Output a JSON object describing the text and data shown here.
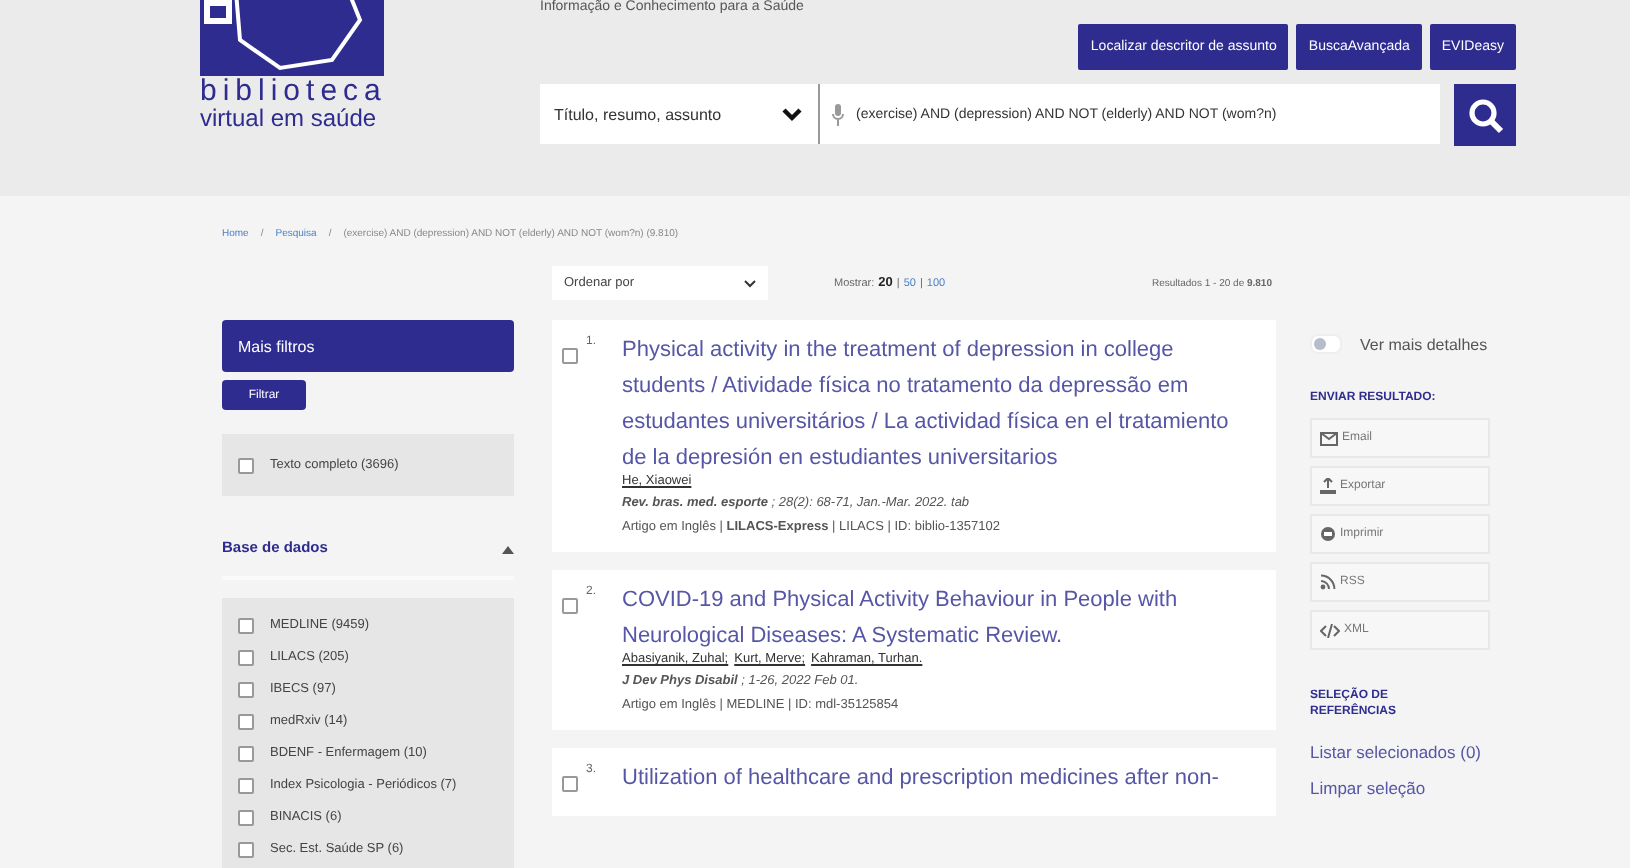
{
  "header": {
    "tagline": "Informação e Conhecimento para a Saúde",
    "logo_lines": [
      "biblioteca",
      "virtual em saúde"
    ],
    "buttons": [
      "Localizar descritor de assunto",
      "BuscaAvançada",
      "EVIDeasy"
    ],
    "search": {
      "field": "Título, resumo, assunto",
      "value": "(exercise) AND (depression) AND NOT (elderly) AND NOT (wom?n)"
    }
  },
  "breadcrumb": [
    {
      "kind": "link",
      "text": "Home"
    },
    {
      "kind": "separator",
      "text": "/"
    },
    {
      "kind": "link",
      "text": "Pesquisa"
    },
    {
      "kind": "separator",
      "text": "/"
    },
    {
      "kind": "current",
      "text": "(exercise) AND (depression) AND NOT (elderly) AND NOT (wom?n) (9.810)"
    }
  ],
  "toolbar": {
    "sort": "Ordenar por",
    "show_label": "Mostrar:",
    "page_sizes": [
      {
        "label": "20",
        "selected": true
      },
      {
        "label": "50",
        "selected": false
      },
      {
        "label": "100",
        "selected": false
      }
    ],
    "page_size_separators": [
      "|",
      "|"
    ],
    "results_text": "Resultados 1 - 20 de **9.810**"
  },
  "sidebar": {
    "more_filters": "Mais filtros",
    "filter_button": "Filtrar",
    "full_text": {
      "label": "Texto completo (3696)",
      "checked": false
    },
    "section": {
      "title": "Base de dados",
      "expanded": true,
      "items": [
        {
          "label": "MEDLINE (9459)",
          "checked": false
        },
        {
          "label": "LILACS (205)",
          "checked": false
        },
        {
          "label": "IBECS (97)",
          "checked": false
        },
        {
          "label": "medRxiv (14)",
          "checked": false
        },
        {
          "label": "BDENF - Enfermagem (10)",
          "checked": false
        },
        {
          "label": "Index Psicologia - Periódicos (7)",
          "checked": false
        },
        {
          "label": "BINACIS (6)",
          "checked": false
        },
        {
          "label": "Sec. Est. Saúde SP (6)",
          "checked": false
        }
      ]
    }
  },
  "results": [
    {
      "number": "1.",
      "checked": false,
      "title": "Physical activity in the treatment of depression in college students / Atividade física no tratamento da depressão em estudantes universitários / La actividad física en el tratamiento de la depresión en estudiantes universitarios",
      "authors": [
        "He, Xiaowei"
      ],
      "journal": "**Rev. bras. med. esporte** ; 28(2): 68-71, Jan.-Mar. 2022. tab",
      "meta": "Artigo em Inglês | **LILACS-Express** | LILACS | ID: biblio-1357102"
    },
    {
      "number": "2.",
      "checked": false,
      "title": "COVID-19 and Physical Activity Behaviour in People with Neurological Diseases: A Systematic Review.",
      "authors": [
        "Abasiyanik, Zuhal;",
        "Kurt, Merve;",
        "Kahraman, Turhan."
      ],
      "journal": "**J Dev Phys Disabil** ; 1-26, 2022 Feb 01.",
      "meta": "Artigo em Inglês | MEDLINE | ID: mdl-35125854"
    },
    {
      "number": "3.",
      "checked": false,
      "title": "Utilization of healthcare and prescription medicines after non-"
    }
  ],
  "aside": {
    "details_toggle": {
      "label": "Ver mais detalhes",
      "on": false
    },
    "send_heading": "ENVIAR RESULTADO:",
    "send_buttons": [
      {
        "kind": "email",
        "label": "Email"
      },
      {
        "kind": "export",
        "label": "Exportar"
      },
      {
        "kind": "print",
        "label": "Imprimir"
      },
      {
        "kind": "rss",
        "label": "RSS"
      },
      {
        "kind": "xml",
        "label": "XML"
      }
    ],
    "selection_heading": "SELEÇÃO DE REFERÊNCIAS",
    "selection_links": [
      "Listar selecionados (0)",
      "Limpar seleção"
    ]
  }
}
